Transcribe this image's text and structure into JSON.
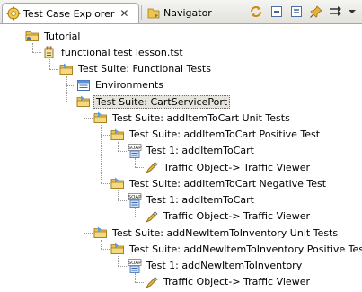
{
  "tabs": [
    {
      "label": "Test Case Explorer",
      "icon": "gear-icon",
      "closable": true,
      "active": true
    },
    {
      "label": "Navigator",
      "icon": "navigator-icon",
      "active": false
    }
  ],
  "toolbar": [
    "refresh-icon",
    "collapse-all-icon",
    "expand-all-icon",
    "pin-icon",
    "link-with-editor-icon"
  ],
  "tree": [
    {
      "label": "Tutorial",
      "icon": "project-folder-icon",
      "level": 0
    },
    {
      "label": "functional test lesson.tst",
      "icon": "test-file-icon",
      "level": 1
    },
    {
      "label": "Test Suite: Functional Tests",
      "icon": "test-suite-icon",
      "level": 2
    },
    {
      "label": "Environments",
      "icon": "environments-icon",
      "level": 3
    },
    {
      "label": "Test Suite: CartServicePort",
      "icon": "test-suite-icon",
      "level": 3,
      "selected": true
    },
    {
      "label": "Test Suite: addItemToCart Unit Tests",
      "icon": "test-suite-icon",
      "level": 4
    },
    {
      "label": "Test Suite: addItemToCart Positive Test",
      "icon": "test-suite-icon",
      "level": 5
    },
    {
      "label": "Test 1: addItemToCart",
      "icon": "soap-test-icon",
      "level": 6
    },
    {
      "label": "Traffic Object-> Traffic Viewer",
      "icon": "traffic-icon",
      "level": 7
    },
    {
      "label": "Test Suite: addItemToCart Negative Test",
      "icon": "test-suite-icon",
      "level": 5
    },
    {
      "label": "Test 1: addItemToCart",
      "icon": "soap-test-icon",
      "level": 6
    },
    {
      "label": "Traffic Object-> Traffic Viewer",
      "icon": "traffic-icon",
      "level": 7
    },
    {
      "label": "Test Suite: addNewItemToInventory Unit Tests",
      "icon": "test-suite-icon",
      "level": 4
    },
    {
      "label": "Test Suite: addNewItemToInventory Positive Test",
      "icon": "test-suite-icon",
      "level": 5
    },
    {
      "label": "Test 1: addNewItemToInventory",
      "icon": "soap-test-icon",
      "level": 6
    },
    {
      "label": "Traffic Object-> Traffic Viewer",
      "icon": "traffic-icon",
      "level": 7
    }
  ]
}
